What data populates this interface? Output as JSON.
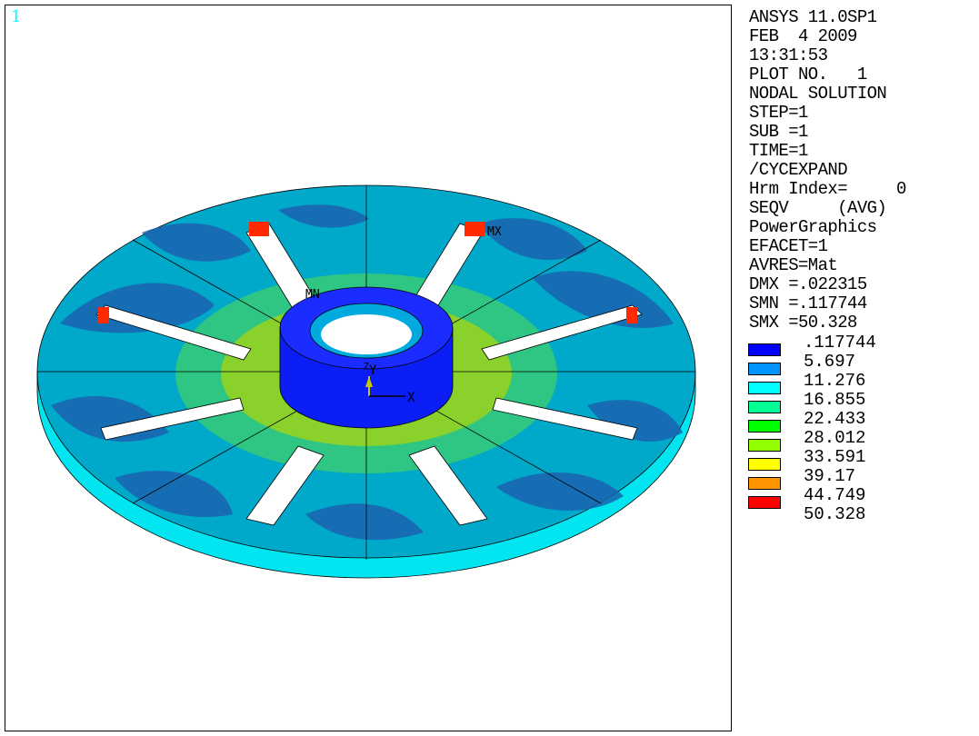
{
  "viewport": {
    "window_number": "1",
    "triad": {
      "x_label": "X",
      "y_label": "Y",
      "z_label": "Z"
    },
    "markers": {
      "max_label": "MX",
      "min_label": "MN"
    }
  },
  "info": {
    "lines": [
      "ANSYS 11.0SP1",
      "FEB  4 2009",
      "13:31:53",
      "PLOT NO.   1",
      "NODAL SOLUTION",
      "STEP=1",
      "SUB =1",
      "TIME=1",
      "/CYCEXPAND",
      "Hrm Index=     0",
      "SEQV     (AVG)",
      "PowerGraphics",
      "EFACET=1",
      "AVRES=Mat",
      "DMX =.022315",
      "SMN =.117744",
      "SMX =50.328"
    ]
  },
  "legend": {
    "values": [
      ".117744",
      "5.697",
      "11.276",
      "16.855",
      "22.433",
      "28.012",
      "33.591",
      "39.17",
      "44.749",
      "50.328"
    ],
    "colors": [
      "#0000ff",
      "#0094ff",
      "#00ffff",
      "#00ff94",
      "#00ff00",
      "#94ff00",
      "#ffff00",
      "#ff9400",
      "#ff0000"
    ]
  },
  "colors": {
    "disc_base": "#00a9c9",
    "disc_dark": "#1a63b0",
    "disc_rim": "#00ffff",
    "hub": "#0000ff",
    "background": "#ffffff",
    "window_number": "#00ffff"
  }
}
